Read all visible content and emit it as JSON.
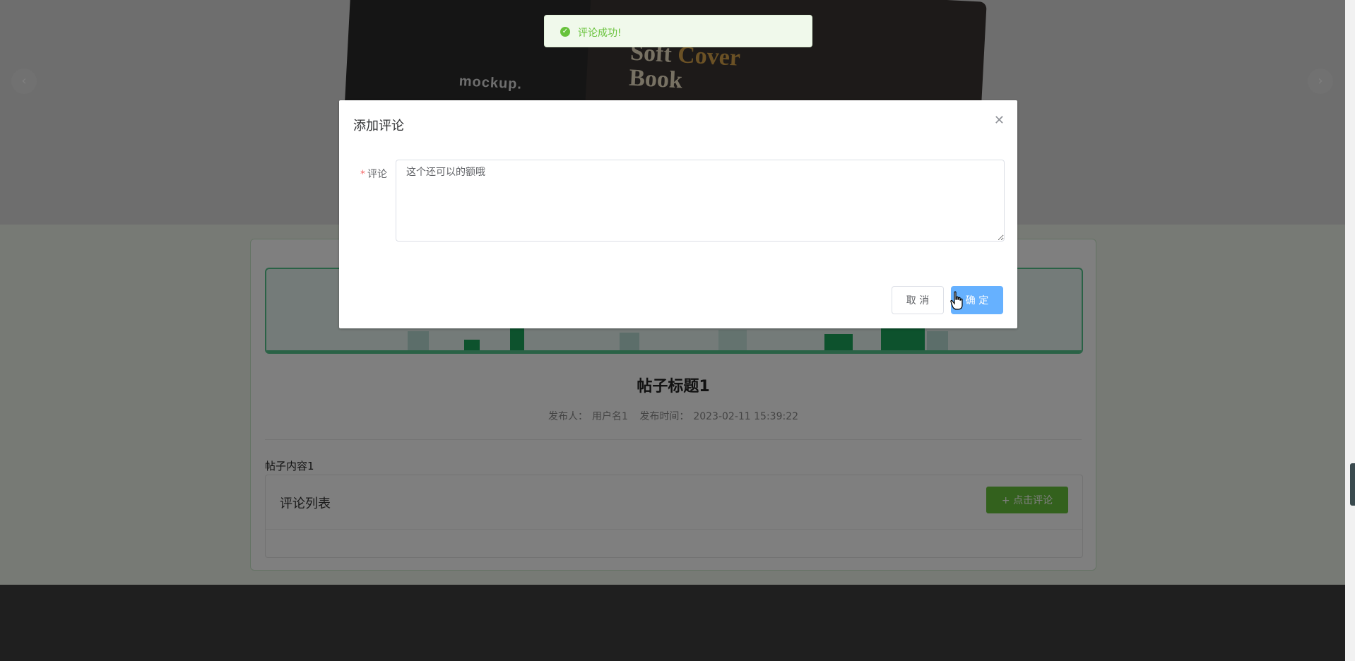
{
  "carousel": {
    "book_mock_text": "mockup.",
    "book_title_line1": "Soft",
    "book_title_line1_gold": "Cover",
    "book_title_line2": "Book",
    "prev_icon": "chevron-left-icon",
    "next_icon": "chevron-right-icon"
  },
  "post": {
    "title": "帖子标题1",
    "publisher_label": "发布人：",
    "publisher": "用户名1",
    "time_label": "发布时间：",
    "time": "2023-02-11 15:39:22",
    "content": "帖子内容1"
  },
  "comments": {
    "heading": "评论列表",
    "add_button": "+ 点击评论"
  },
  "toast": {
    "message": "评论成功!",
    "icon": "check-circle-icon",
    "color": "#67c23a"
  },
  "dialog": {
    "title": "添加评论",
    "close_icon": "close-icon",
    "field_label": "评论",
    "field_value": "这个还可以的额哦",
    "cancel_label": "取 消",
    "confirm_label": "确 定"
  },
  "colors": {
    "primary": "#409eff",
    "success": "#67c23a",
    "banner_green": "#55c58c"
  }
}
